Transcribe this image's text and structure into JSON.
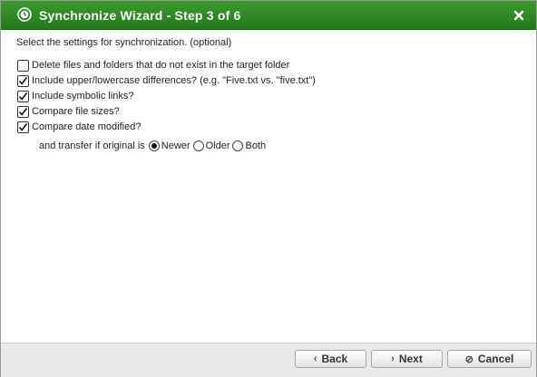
{
  "titlebar": {
    "title": "Synchronize Wizard - Step 3 of 6",
    "icon": "sync-clock-icon",
    "close_icon": "close-icon",
    "color": "#2e8a25"
  },
  "subtitle": "Select the settings for synchronization. (optional)",
  "options": [
    {
      "label": "Delete files and folders that do not exist in the target folder",
      "checked": false
    },
    {
      "label": "Include upper/lowercase differences? (e.g. \"Five.txt vs. \"five.txt\")",
      "checked": true
    },
    {
      "label": "Include symbolic links?",
      "checked": true
    },
    {
      "label": "Compare file sizes?",
      "checked": true
    },
    {
      "label": "Compare date modified?",
      "checked": true
    }
  ],
  "transfer": {
    "prefix": "and transfer if original is",
    "choices": [
      {
        "label": "Newer",
        "selected": true
      },
      {
        "label": "Older",
        "selected": false
      },
      {
        "label": "Both",
        "selected": false
      }
    ]
  },
  "buttons": {
    "back": {
      "label": "Back",
      "icon": "chevron-left-icon"
    },
    "next": {
      "label": "Next",
      "icon": "chevron-right-icon"
    },
    "cancel": {
      "label": "Cancel",
      "icon": "cancel-icon"
    }
  }
}
